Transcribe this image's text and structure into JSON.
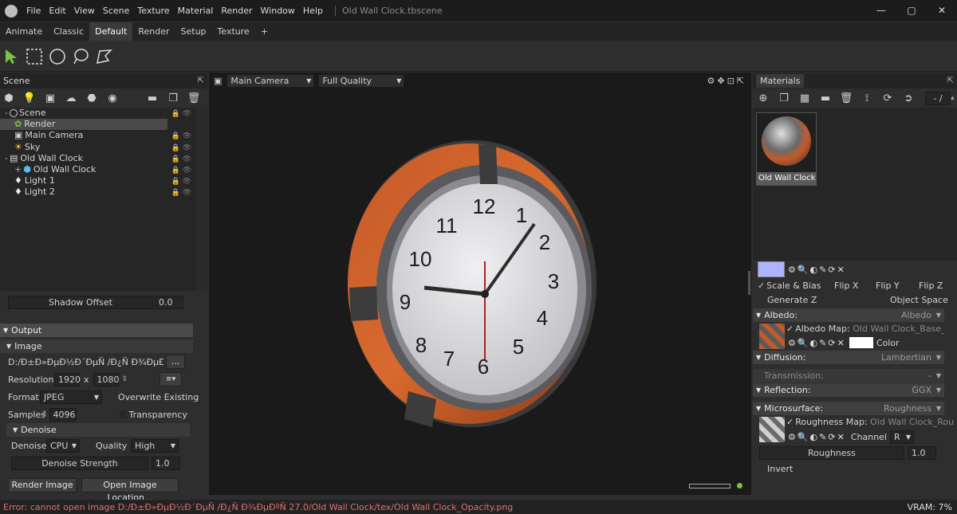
{
  "window": {
    "title": "Old Wall Clock.tbscene",
    "minimize": "—",
    "maximize": "▢",
    "close": "✕"
  },
  "menu": [
    "File",
    "Edit",
    "View",
    "Scene",
    "Texture",
    "Material",
    "Render",
    "Window",
    "Help"
  ],
  "tabs": [
    "Animate",
    "Classic",
    "Default",
    "Render",
    "Setup",
    "Texture",
    "+"
  ],
  "active_tab": "Default",
  "tools": [
    "select-arrow-icon",
    "rect-select-icon",
    "ellipse-select-icon",
    "lasso-select-icon",
    "polygon-select-icon"
  ],
  "scene": {
    "header": "Scene",
    "tree": [
      {
        "label": "Scene",
        "icon": "scene-root-icon"
      },
      {
        "label": "Render",
        "icon": "render-icon"
      },
      {
        "label": "Main Camera",
        "icon": "camera-icon"
      },
      {
        "label": "Sky",
        "icon": "sky-icon"
      },
      {
        "label": "Old Wall Clock",
        "icon": "object-icon"
      },
      {
        "label": "Old Wall Clock",
        "icon": "mesh-icon"
      },
      {
        "label": "Light 1",
        "icon": "light-icon"
      },
      {
        "label": "Light 2",
        "icon": "light-icon"
      }
    ],
    "shadow_offset_label": "Shadow Offset",
    "shadow_offset": "0.0",
    "output_label": "Output",
    "image_label": "Image",
    "path": "D:/Ð±Ð»ÐµÐ½Ð´ÐµÑ /Ð¿Ñ Ð¾ÐµÐºÑ",
    "path_button": "...",
    "resolution_label": "Resolution:",
    "res_w": "1920",
    "res_x": "x",
    "res_h": "1080",
    "format_label": "Format",
    "format": "JPEG",
    "overwrite_label": "Overwrite Existing",
    "samples_label": "Samples",
    "samples": "4096",
    "transparency_label": "Transparency",
    "denoise_section": "Denoise",
    "denoise_label": "Denoise",
    "denoise": "CPU",
    "quality_label": "Quality",
    "quality": "High",
    "denoise_strength_label": "Denoise Strength",
    "denoise_strength": "1.0",
    "render_image": "Render Image",
    "open_location": "Open Image Location..."
  },
  "viewport": {
    "camera": "Main Camera",
    "quality": "Full Quality",
    "numbers": [
      "12",
      "1",
      "2",
      "3",
      "4",
      "5",
      "6",
      "7",
      "8",
      "9",
      "10",
      "11"
    ]
  },
  "materials": {
    "header": "Materials",
    "counter": "- /",
    "thumb_label": "Old Wall Clock",
    "scale_bias": "Scale & Bias",
    "flip_x": "Flip X",
    "flip_y": "Flip Y",
    "flip_z": "Flip Z",
    "generate_z": "Generate Z",
    "object_space": "Object Space",
    "albedo": "Albedo:",
    "albedo_val": "Albedo",
    "albedo_map_label": "Albedo Map:",
    "albedo_map": "Old Wall Clock_Base_color",
    "color_label": "Color",
    "diffusion": "Diffusion:",
    "diffusion_val": "Lambertian",
    "transmission": "Transmission:",
    "transmission_val": "-",
    "reflection": "Reflection:",
    "reflection_val": "GGX",
    "microsurface": "Microsurface:",
    "microsurface_val": "Roughness",
    "roughness_map_label": "Roughness Map:",
    "roughness_map": "Old Wall Clock_Rough",
    "channel_label": "Channel",
    "channel": "R",
    "roughness_label": "Roughness",
    "roughness": "1.0",
    "invert_label": "Invert"
  },
  "status": {
    "error": "Error: cannot open image D:/Ð±Ð»ÐµÐ½Ð´ÐµÑ /Ð¿Ñ Ð¾ÐµÐºÑ  27.0/Old Wall Clock/tex/Old Wall Clock_Opacity.png",
    "vram": "VRAM: 7%"
  },
  "colors": {
    "accent_green": "#7ec243",
    "error": "#e0706a",
    "albedo_swatch": "#aeb2ff"
  }
}
